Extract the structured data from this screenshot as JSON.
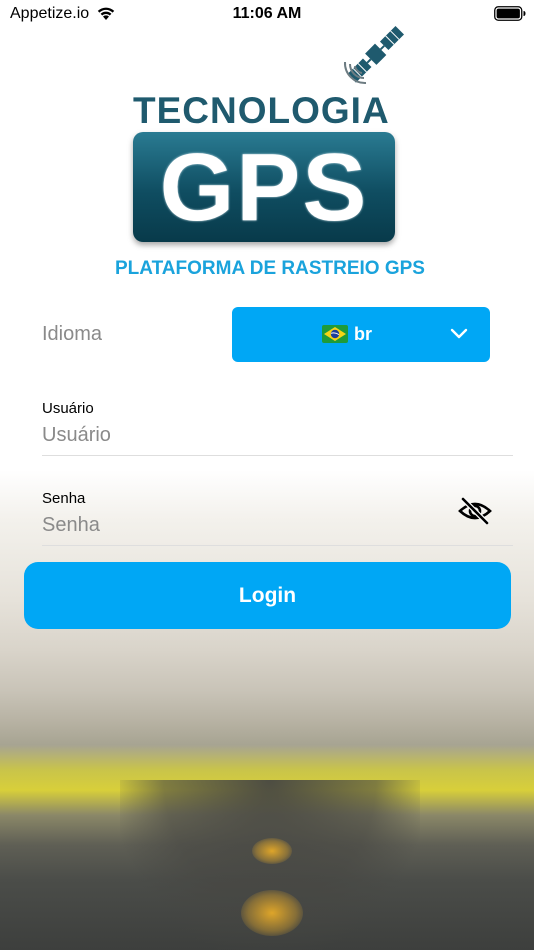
{
  "status_bar": {
    "carrier": "Appetize.io",
    "time": "11:06 AM",
    "wifi_icon": "wifi-icon",
    "battery_icon": "battery-full-icon"
  },
  "logo": {
    "top_text": "TECNOLOGIA",
    "main_text": "GPS",
    "subtitle": "PLATAFORMA DE RASTREIO GPS",
    "icon": "satellite-icon"
  },
  "language": {
    "label": "Idioma",
    "selected": "br",
    "flag_icon": "brazil-flag-icon",
    "chevron_icon": "chevron-down-icon"
  },
  "username": {
    "label": "Usuário",
    "placeholder": "Usuário",
    "value": ""
  },
  "password": {
    "label": "Senha",
    "placeholder": "Senha",
    "value": "",
    "toggle_icon": "eye-off-icon"
  },
  "login_button": {
    "label": "Login"
  },
  "colors": {
    "accent": "#00a7f5",
    "subtitle": "#1aa3dc",
    "logo_dark": "#0f4d61",
    "placeholder": "#8a8a8a"
  }
}
